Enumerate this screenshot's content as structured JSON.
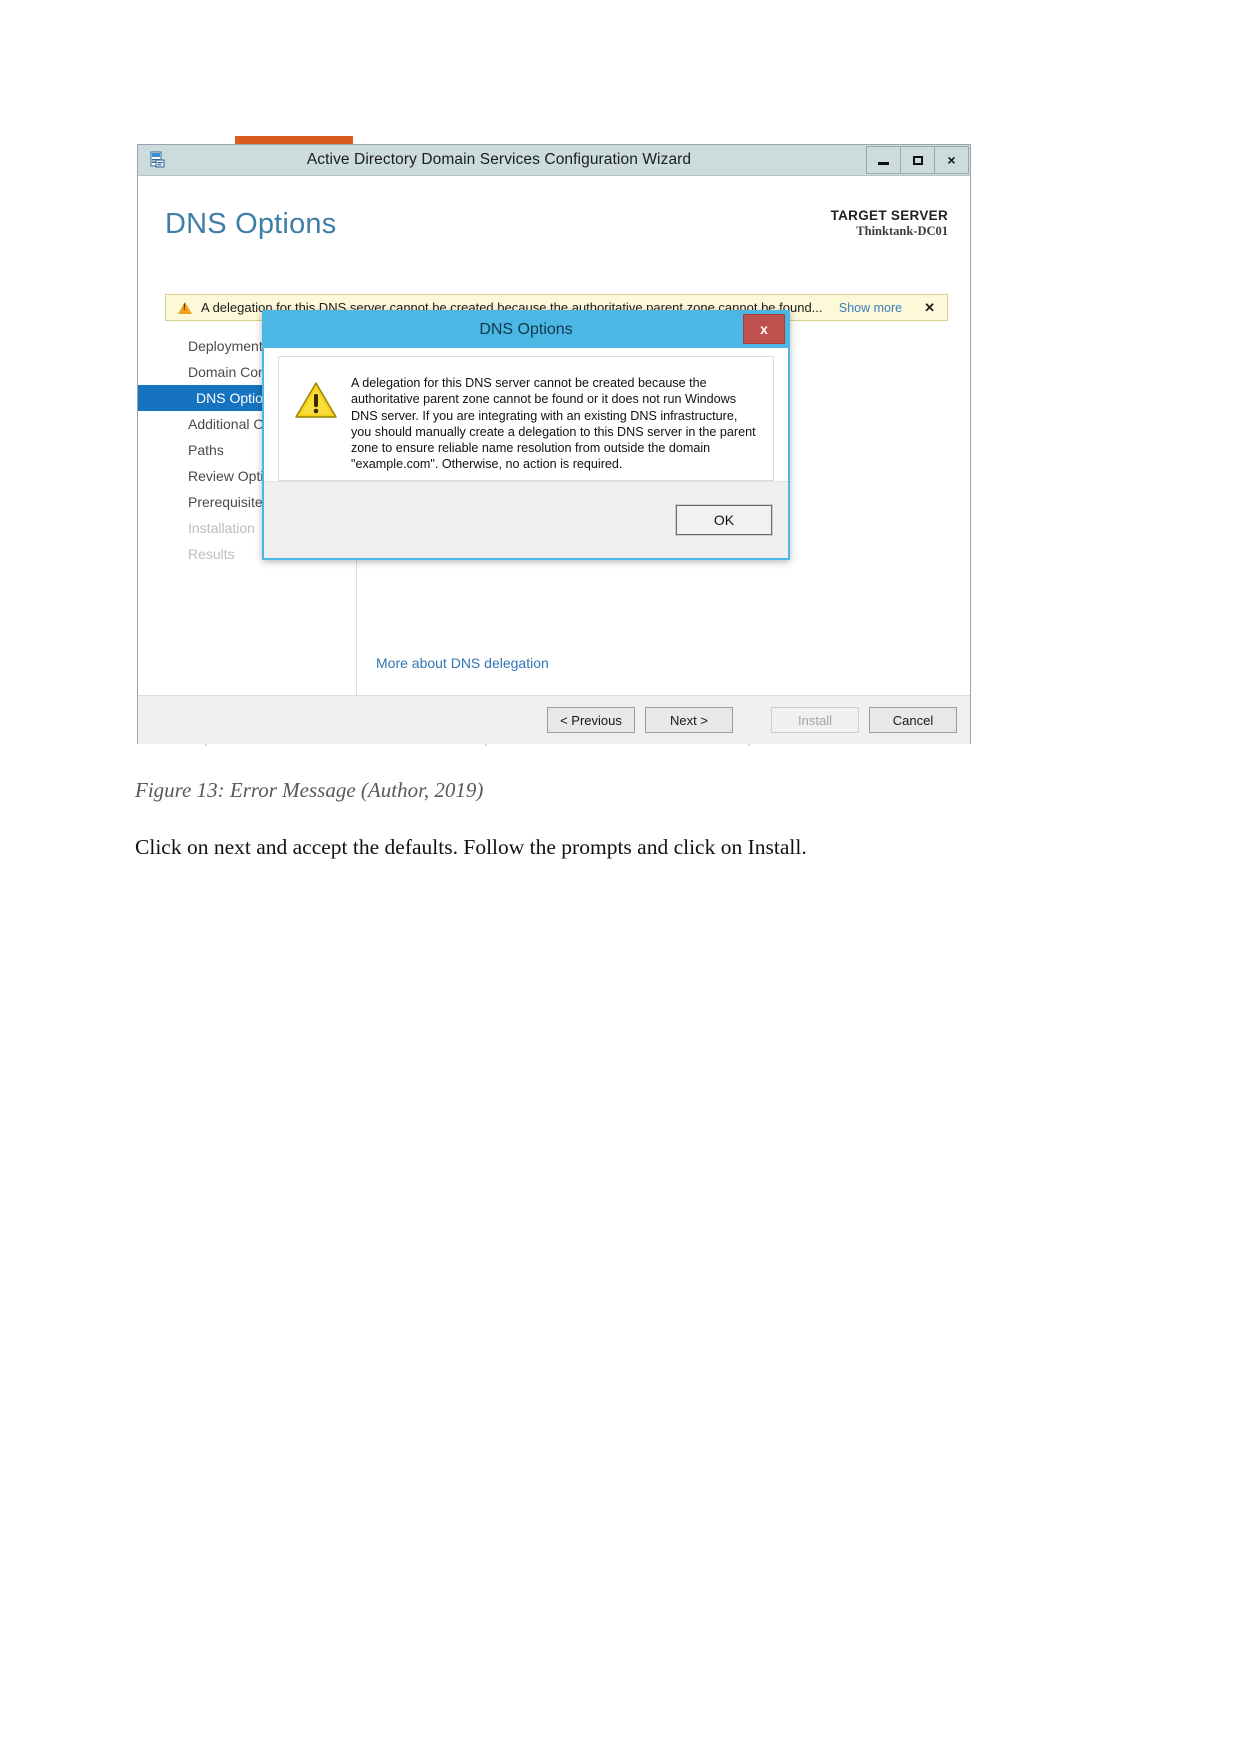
{
  "document": {
    "figure_caption": "Figure 13: Error Message (Author, 2019)",
    "paragraph": "Click on next and accept the defaults. Follow the prompts and click on Install."
  },
  "window": {
    "title": "Active Directory Domain Services Configuration Wizard",
    "icon": "wizard-app-icon",
    "controls": {
      "minimize": "minimize-icon",
      "maximize": "maximize-icon",
      "close": "×"
    }
  },
  "wizard": {
    "page_heading": "DNS Options",
    "target_server_label": "TARGET SERVER",
    "target_server_name": "Thinktank-DC01",
    "notification": {
      "icon": "warning-icon",
      "text": "A delegation for this DNS server cannot be created because the authoritative parent zone cannot be found...",
      "show_more": "Show more",
      "close": "✕"
    },
    "nav_items": [
      {
        "label": "Deployment Configuration",
        "state": "normal"
      },
      {
        "label": "Domain Controller Options",
        "state": "normal"
      },
      {
        "label": "DNS Options",
        "state": "active"
      },
      {
        "label": "Additional Options",
        "state": "normal"
      },
      {
        "label": "Paths",
        "state": "normal"
      },
      {
        "label": "Review Options",
        "state": "normal"
      },
      {
        "label": "Prerequisites Check",
        "state": "normal"
      },
      {
        "label": "Installation",
        "state": "disabled"
      },
      {
        "label": "Results",
        "state": "disabled"
      }
    ],
    "more_link": "More about DNS delegation",
    "footer_buttons": [
      {
        "label": "< Previous",
        "state": "enabled"
      },
      {
        "label": "Next >",
        "state": "enabled"
      },
      {
        "label": "Install",
        "state": "disabled"
      },
      {
        "label": "Cancel",
        "state": "enabled"
      }
    ]
  },
  "dialog": {
    "title": "DNS Options",
    "close_label": "x",
    "icon": "warning-triangle-icon",
    "message": "A delegation for this DNS server cannot be created because the authoritative parent zone cannot be found or it does not run Windows DNS server. If you are integrating with an existing DNS infrastructure, you should manually create a delegation to this DNS server in the parent zone to ensure reliable name resolution from outside the domain \"example.com\". Otherwise, no action is required.",
    "ok_label": "OK"
  },
  "colors": {
    "titlebar": "#ccdcdd",
    "heading": "#3f7fa6",
    "nav_active": "#1673c0",
    "dialog_accent": "#4cb6e5",
    "dialog_close": "#c0504d",
    "notification_bg": "#fdf8d8",
    "warning": "#f0a01e",
    "link": "#2f76b5"
  }
}
